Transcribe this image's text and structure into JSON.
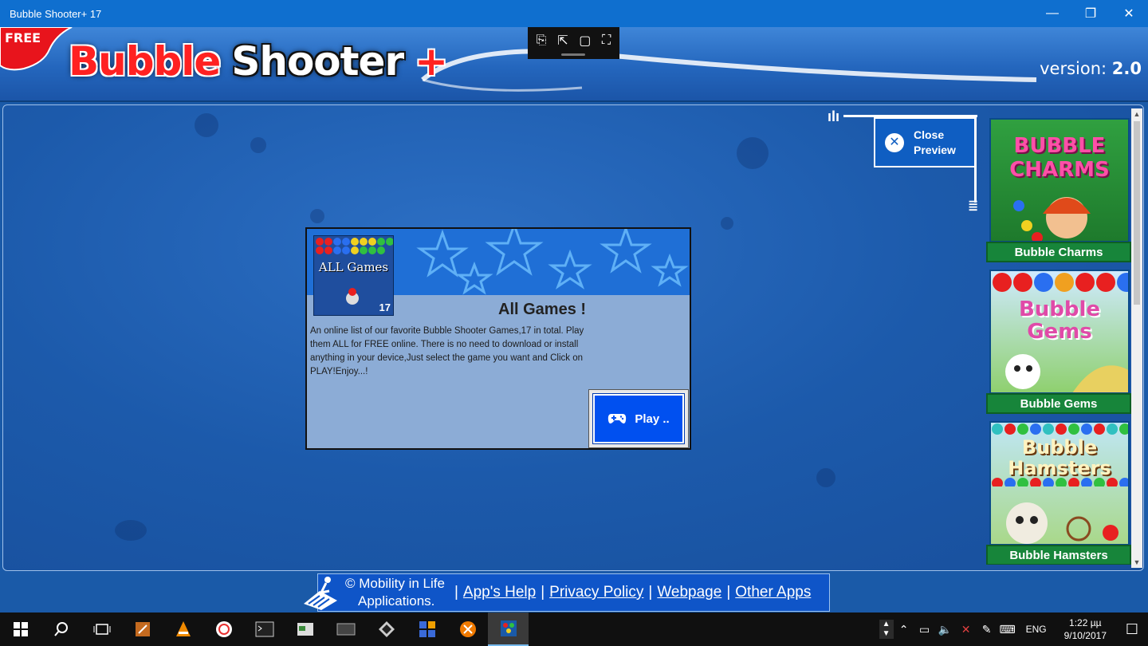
{
  "window": {
    "title": "Bubble Shooter+ 17",
    "minimize_icon": "—",
    "restore_icon": "❐",
    "close_icon": "✕"
  },
  "header": {
    "free_badge": "FREE",
    "logo_word1": "Bubble",
    "logo_word2": "Shooter",
    "logo_plus": "+",
    "version_label": "version:",
    "version_value": "2.0"
  },
  "snip_toolbar": [
    "⎘",
    "⇱",
    "▢",
    "⛶"
  ],
  "featured_game": {
    "thumbnail_title": "ALL Games",
    "thumbnail_count": "17",
    "title": "All Games !",
    "description": "An online list of our favorite Bubble Shooter Games,17 in total. Play them ALL for FREE online. There is no need to download or install anything in your device,Just select the game you want and Click on PLAY!Enjoy...!",
    "play_label": "Play .."
  },
  "close_preview": {
    "label_line1": "Close",
    "label_line2": "Preview"
  },
  "game_list": [
    {
      "name": "Bubble Charms",
      "art": "BUBBLE CHARMS"
    },
    {
      "name": "Bubble Gems",
      "art": "Bubble Gems"
    },
    {
      "name": "Bubble Hamsters",
      "art": "Bubble Hamsters"
    }
  ],
  "footer": {
    "copyright_line1": "© Mobility in Life",
    "copyright_line2": "Applications.",
    "separator": "|",
    "links": [
      "App's Help",
      "Privacy Policy",
      "Webpage",
      "Other Apps"
    ]
  },
  "taskbar": {
    "language": "ENG",
    "time": "1:22 µµ",
    "date": "9/10/2017"
  },
  "colors": {
    "titlebar": "#0f6fcf",
    "background": "#1a5aa8",
    "play_button": "#0050f0",
    "list_label": "#17853a"
  }
}
